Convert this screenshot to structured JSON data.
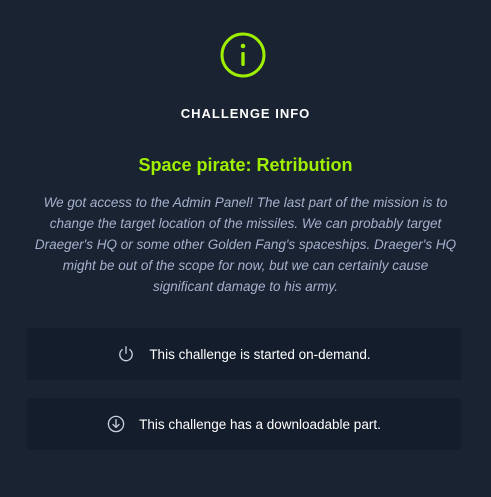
{
  "header": {
    "icon": "info-icon",
    "label": "CHALLENGE INFO"
  },
  "challenge": {
    "title": "Space pirate: Retribution",
    "description": "We got access to the Admin Panel! The last part of the mission is to change the target location of the missiles. We can probably target Draeger's HQ or some other Golden Fang's spaceships. Draeger's HQ might be out of the scope for now, but we can certainly cause significant damage to his army."
  },
  "features": [
    {
      "icon": "power-icon",
      "text": "This challenge is started on-demand."
    },
    {
      "icon": "download-icon",
      "text": "This challenge has a downloadable part."
    }
  ],
  "colors": {
    "background": "#1a2332",
    "card": "#141d2b",
    "accent": "#9fef00",
    "muted_text": "#a4b1cd"
  }
}
